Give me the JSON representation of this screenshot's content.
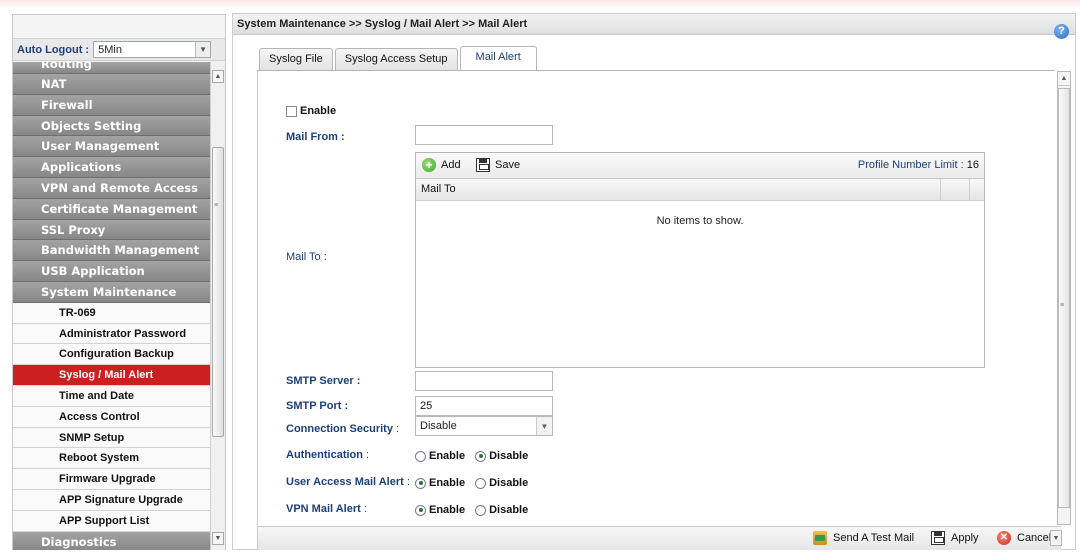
{
  "sidebar": {
    "auto_logout_label": "Auto Logout :",
    "auto_logout_value": "5Min",
    "items": [
      {
        "label": "Routing",
        "type": "main",
        "cut": true
      },
      {
        "label": "NAT",
        "type": "main"
      },
      {
        "label": "Firewall",
        "type": "main"
      },
      {
        "label": "Objects Setting",
        "type": "main"
      },
      {
        "label": "User Management",
        "type": "main"
      },
      {
        "label": "Applications",
        "type": "main"
      },
      {
        "label": "VPN and Remote Access",
        "type": "main"
      },
      {
        "label": "Certificate Management",
        "type": "main"
      },
      {
        "label": "SSL Proxy",
        "type": "main"
      },
      {
        "label": "Bandwidth Management",
        "type": "main"
      },
      {
        "label": "USB Application",
        "type": "main"
      },
      {
        "label": "System Maintenance",
        "type": "main"
      },
      {
        "label": "TR-069",
        "type": "sub"
      },
      {
        "label": "Administrator Password",
        "type": "sub"
      },
      {
        "label": "Configuration Backup",
        "type": "sub"
      },
      {
        "label": "Syslog / Mail Alert",
        "type": "sub",
        "active": true
      },
      {
        "label": "Time and Date",
        "type": "sub"
      },
      {
        "label": "Access Control",
        "type": "sub"
      },
      {
        "label": "SNMP Setup",
        "type": "sub"
      },
      {
        "label": "Reboot System",
        "type": "sub"
      },
      {
        "label": "Firmware Upgrade",
        "type": "sub"
      },
      {
        "label": "APP Signature Upgrade",
        "type": "sub"
      },
      {
        "label": "APP Support List",
        "type": "sub"
      },
      {
        "label": "Diagnostics",
        "type": "main"
      }
    ]
  },
  "header": {
    "breadcrumb": "System Maintenance >> Syslog / Mail Alert >> Mail Alert",
    "help": "?"
  },
  "tabs": [
    "Syslog File",
    "Syslog Access Setup",
    "Mail Alert"
  ],
  "active_tab": 2,
  "form": {
    "enable_label": "Enable",
    "mail_from_label": "Mail From :",
    "mail_from_value": "",
    "mail_to_label": "Mail To :",
    "grid": {
      "add_label": "Add",
      "save_label": "Save",
      "limit_label": "Profile Number Limit :",
      "limit_value": "16",
      "column": "Mail To",
      "empty": "No items to show."
    },
    "smtp_server_label": "SMTP Server :",
    "smtp_server_value": "",
    "smtp_port_label": "SMTP Port :",
    "smtp_port_value": "25",
    "connection_security_label": "Connection Security",
    "connection_security_colon": " :",
    "connection_security_value": "Disable",
    "authentication_label": "Authentication",
    "user_access_label": "User Access Mail Alert",
    "vpn_label": "VPN Mail Alert",
    "colon": " :",
    "opt_enable": "Enable",
    "opt_disable": "Disable",
    "authentication_selected": "Disable",
    "user_access_selected": "Enable",
    "vpn_selected": "Enable"
  },
  "footer": {
    "test_mail": "Send A Test Mail",
    "apply": "Apply",
    "cancel": "Cancel"
  }
}
